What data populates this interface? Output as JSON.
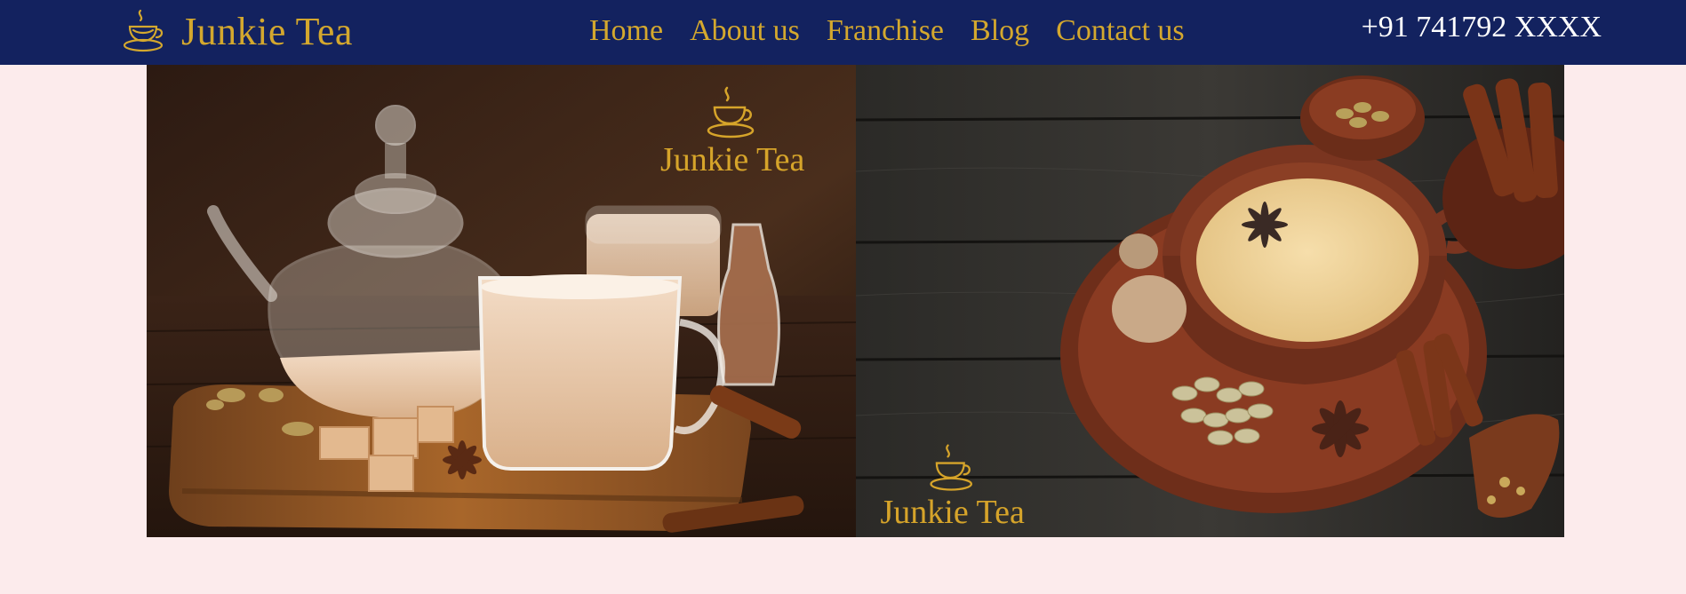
{
  "header": {
    "brand": "Junkie Tea",
    "nav": [
      {
        "label": "Home"
      },
      {
        "label": "About us"
      },
      {
        "label": "Franchise"
      },
      {
        "label": "Blog"
      },
      {
        "label": "Contact us"
      }
    ],
    "phone": "+91 741792 XXXX"
  },
  "hero": {
    "slides": [
      {
        "watermark": "Junkie Tea",
        "subject": "glass-teapot-with-masala-chai"
      },
      {
        "watermark": "Junkie Tea",
        "subject": "clay-cup-with-masala-chai-and-spices"
      }
    ]
  },
  "colors": {
    "nav_background": "#13225f",
    "brand_gold": "#d4a82e",
    "page_background": "#fcebec",
    "phone_text": "#ffffff"
  }
}
